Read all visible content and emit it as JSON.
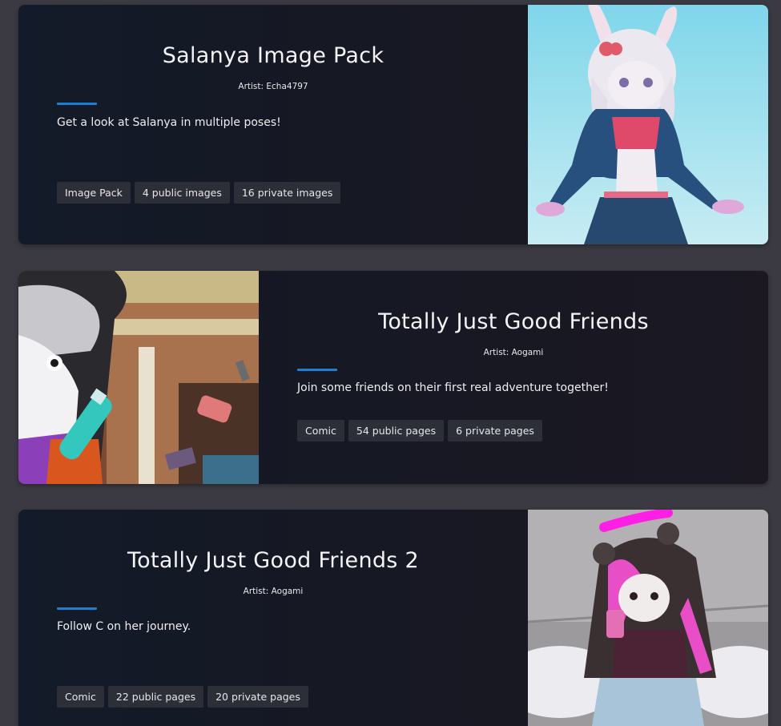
{
  "cards": [
    {
      "title": "Salanya Image Pack",
      "artist": "Artist: Echa4797",
      "description": "Get a look at Salanya in multiple poses!",
      "tags": [
        "Image Pack",
        "4 public images",
        "16 private images"
      ],
      "image_position": "right"
    },
    {
      "title": "Totally Just Good Friends",
      "artist": "Artist: Aogami",
      "description": "Join some friends on their first real adventure together!",
      "tags": [
        "Comic",
        "54 public pages",
        "6 private pages"
      ],
      "image_position": "left"
    },
    {
      "title": "Totally Just Good Friends 2",
      "artist": "Artist: Aogami",
      "description": "Follow C on her journey.",
      "tags": [
        "Comic",
        "22 public pages",
        "20 private pages"
      ],
      "image_position": "right"
    }
  ],
  "colors": {
    "page_background": "#3b3a42",
    "card_background": "#161823",
    "accent": "#1e7fd1",
    "tag_background": "#2d2f38"
  }
}
